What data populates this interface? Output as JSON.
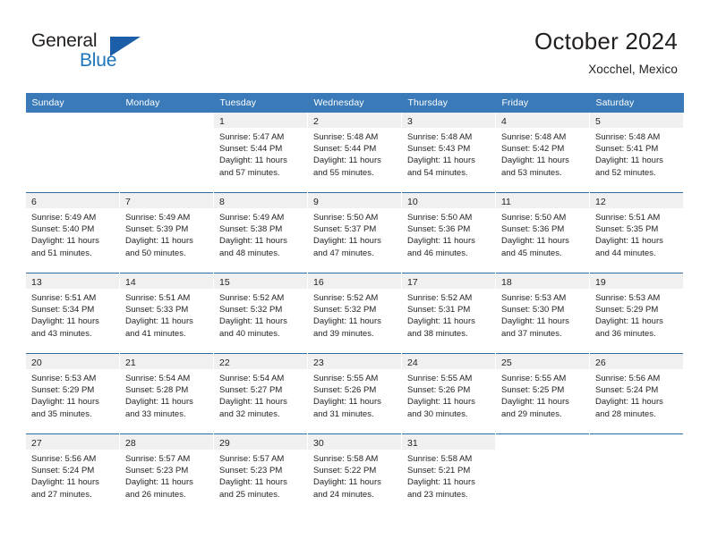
{
  "brand": {
    "name_part1": "General",
    "name_part2": "Blue",
    "triangle_icon": "brand-triangle-icon"
  },
  "header": {
    "title": "October 2024",
    "subtitle": "Xocchel, Mexico"
  },
  "colors": {
    "header_blue": "#3a7ab8",
    "separator_blue": "#2e6da4",
    "daynum_band": "#f0f0f0",
    "brand_blue": "#1c75bc",
    "text": "#231f20"
  },
  "calendar": {
    "weekday_headers": [
      "Sunday",
      "Monday",
      "Tuesday",
      "Wednesday",
      "Thursday",
      "Friday",
      "Saturday"
    ],
    "weeks": [
      [
        {
          "day": "",
          "empty": true,
          "sunrise": "",
          "sunset": "",
          "daylight_l1": "",
          "daylight_l2": ""
        },
        {
          "day": "",
          "empty": true,
          "sunrise": "",
          "sunset": "",
          "daylight_l1": "",
          "daylight_l2": ""
        },
        {
          "day": "1",
          "empty": false,
          "sunrise": "Sunrise: 5:47 AM",
          "sunset": "Sunset: 5:44 PM",
          "daylight_l1": "Daylight: 11 hours",
          "daylight_l2": "and 57 minutes."
        },
        {
          "day": "2",
          "empty": false,
          "sunrise": "Sunrise: 5:48 AM",
          "sunset": "Sunset: 5:44 PM",
          "daylight_l1": "Daylight: 11 hours",
          "daylight_l2": "and 55 minutes."
        },
        {
          "day": "3",
          "empty": false,
          "sunrise": "Sunrise: 5:48 AM",
          "sunset": "Sunset: 5:43 PM",
          "daylight_l1": "Daylight: 11 hours",
          "daylight_l2": "and 54 minutes."
        },
        {
          "day": "4",
          "empty": false,
          "sunrise": "Sunrise: 5:48 AM",
          "sunset": "Sunset: 5:42 PM",
          "daylight_l1": "Daylight: 11 hours",
          "daylight_l2": "and 53 minutes."
        },
        {
          "day": "5",
          "empty": false,
          "sunrise": "Sunrise: 5:48 AM",
          "sunset": "Sunset: 5:41 PM",
          "daylight_l1": "Daylight: 11 hours",
          "daylight_l2": "and 52 minutes."
        }
      ],
      [
        {
          "day": "6",
          "empty": false,
          "sunrise": "Sunrise: 5:49 AM",
          "sunset": "Sunset: 5:40 PM",
          "daylight_l1": "Daylight: 11 hours",
          "daylight_l2": "and 51 minutes."
        },
        {
          "day": "7",
          "empty": false,
          "sunrise": "Sunrise: 5:49 AM",
          "sunset": "Sunset: 5:39 PM",
          "daylight_l1": "Daylight: 11 hours",
          "daylight_l2": "and 50 minutes."
        },
        {
          "day": "8",
          "empty": false,
          "sunrise": "Sunrise: 5:49 AM",
          "sunset": "Sunset: 5:38 PM",
          "daylight_l1": "Daylight: 11 hours",
          "daylight_l2": "and 48 minutes."
        },
        {
          "day": "9",
          "empty": false,
          "sunrise": "Sunrise: 5:50 AM",
          "sunset": "Sunset: 5:37 PM",
          "daylight_l1": "Daylight: 11 hours",
          "daylight_l2": "and 47 minutes."
        },
        {
          "day": "10",
          "empty": false,
          "sunrise": "Sunrise: 5:50 AM",
          "sunset": "Sunset: 5:36 PM",
          "daylight_l1": "Daylight: 11 hours",
          "daylight_l2": "and 46 minutes."
        },
        {
          "day": "11",
          "empty": false,
          "sunrise": "Sunrise: 5:50 AM",
          "sunset": "Sunset: 5:36 PM",
          "daylight_l1": "Daylight: 11 hours",
          "daylight_l2": "and 45 minutes."
        },
        {
          "day": "12",
          "empty": false,
          "sunrise": "Sunrise: 5:51 AM",
          "sunset": "Sunset: 5:35 PM",
          "daylight_l1": "Daylight: 11 hours",
          "daylight_l2": "and 44 minutes."
        }
      ],
      [
        {
          "day": "13",
          "empty": false,
          "sunrise": "Sunrise: 5:51 AM",
          "sunset": "Sunset: 5:34 PM",
          "daylight_l1": "Daylight: 11 hours",
          "daylight_l2": "and 43 minutes."
        },
        {
          "day": "14",
          "empty": false,
          "sunrise": "Sunrise: 5:51 AM",
          "sunset": "Sunset: 5:33 PM",
          "daylight_l1": "Daylight: 11 hours",
          "daylight_l2": "and 41 minutes."
        },
        {
          "day": "15",
          "empty": false,
          "sunrise": "Sunrise: 5:52 AM",
          "sunset": "Sunset: 5:32 PM",
          "daylight_l1": "Daylight: 11 hours",
          "daylight_l2": "and 40 minutes."
        },
        {
          "day": "16",
          "empty": false,
          "sunrise": "Sunrise: 5:52 AM",
          "sunset": "Sunset: 5:32 PM",
          "daylight_l1": "Daylight: 11 hours",
          "daylight_l2": "and 39 minutes."
        },
        {
          "day": "17",
          "empty": false,
          "sunrise": "Sunrise: 5:52 AM",
          "sunset": "Sunset: 5:31 PM",
          "daylight_l1": "Daylight: 11 hours",
          "daylight_l2": "and 38 minutes."
        },
        {
          "day": "18",
          "empty": false,
          "sunrise": "Sunrise: 5:53 AM",
          "sunset": "Sunset: 5:30 PM",
          "daylight_l1": "Daylight: 11 hours",
          "daylight_l2": "and 37 minutes."
        },
        {
          "day": "19",
          "empty": false,
          "sunrise": "Sunrise: 5:53 AM",
          "sunset": "Sunset: 5:29 PM",
          "daylight_l1": "Daylight: 11 hours",
          "daylight_l2": "and 36 minutes."
        }
      ],
      [
        {
          "day": "20",
          "empty": false,
          "sunrise": "Sunrise: 5:53 AM",
          "sunset": "Sunset: 5:29 PM",
          "daylight_l1": "Daylight: 11 hours",
          "daylight_l2": "and 35 minutes."
        },
        {
          "day": "21",
          "empty": false,
          "sunrise": "Sunrise: 5:54 AM",
          "sunset": "Sunset: 5:28 PM",
          "daylight_l1": "Daylight: 11 hours",
          "daylight_l2": "and 33 minutes."
        },
        {
          "day": "22",
          "empty": false,
          "sunrise": "Sunrise: 5:54 AM",
          "sunset": "Sunset: 5:27 PM",
          "daylight_l1": "Daylight: 11 hours",
          "daylight_l2": "and 32 minutes."
        },
        {
          "day": "23",
          "empty": false,
          "sunrise": "Sunrise: 5:55 AM",
          "sunset": "Sunset: 5:26 PM",
          "daylight_l1": "Daylight: 11 hours",
          "daylight_l2": "and 31 minutes."
        },
        {
          "day": "24",
          "empty": false,
          "sunrise": "Sunrise: 5:55 AM",
          "sunset": "Sunset: 5:26 PM",
          "daylight_l1": "Daylight: 11 hours",
          "daylight_l2": "and 30 minutes."
        },
        {
          "day": "25",
          "empty": false,
          "sunrise": "Sunrise: 5:55 AM",
          "sunset": "Sunset: 5:25 PM",
          "daylight_l1": "Daylight: 11 hours",
          "daylight_l2": "and 29 minutes."
        },
        {
          "day": "26",
          "empty": false,
          "sunrise": "Sunrise: 5:56 AM",
          "sunset": "Sunset: 5:24 PM",
          "daylight_l1": "Daylight: 11 hours",
          "daylight_l2": "and 28 minutes."
        }
      ],
      [
        {
          "day": "27",
          "empty": false,
          "sunrise": "Sunrise: 5:56 AM",
          "sunset": "Sunset: 5:24 PM",
          "daylight_l1": "Daylight: 11 hours",
          "daylight_l2": "and 27 minutes."
        },
        {
          "day": "28",
          "empty": false,
          "sunrise": "Sunrise: 5:57 AM",
          "sunset": "Sunset: 5:23 PM",
          "daylight_l1": "Daylight: 11 hours",
          "daylight_l2": "and 26 minutes."
        },
        {
          "day": "29",
          "empty": false,
          "sunrise": "Sunrise: 5:57 AM",
          "sunset": "Sunset: 5:23 PM",
          "daylight_l1": "Daylight: 11 hours",
          "daylight_l2": "and 25 minutes."
        },
        {
          "day": "30",
          "empty": false,
          "sunrise": "Sunrise: 5:58 AM",
          "sunset": "Sunset: 5:22 PM",
          "daylight_l1": "Daylight: 11 hours",
          "daylight_l2": "and 24 minutes."
        },
        {
          "day": "31",
          "empty": false,
          "sunrise": "Sunrise: 5:58 AM",
          "sunset": "Sunset: 5:21 PM",
          "daylight_l1": "Daylight: 11 hours",
          "daylight_l2": "and 23 minutes."
        },
        {
          "day": "",
          "empty": true,
          "sunrise": "",
          "sunset": "",
          "daylight_l1": "",
          "daylight_l2": ""
        },
        {
          "day": "",
          "empty": true,
          "sunrise": "",
          "sunset": "",
          "daylight_l1": "",
          "daylight_l2": ""
        }
      ]
    ]
  }
}
